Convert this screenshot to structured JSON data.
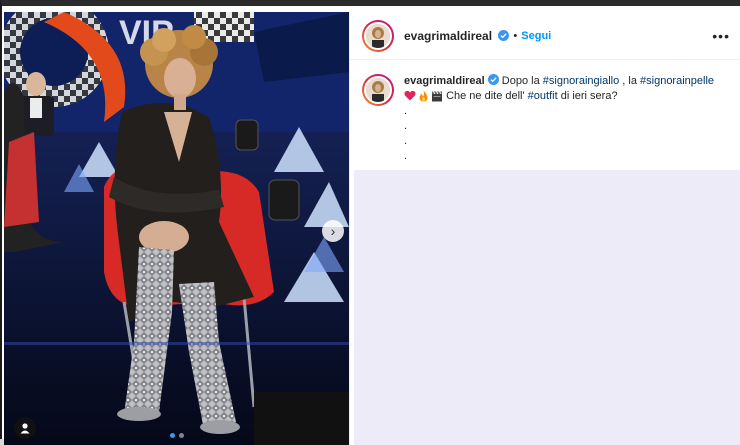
{
  "post": {
    "username": "evagrimaldireal",
    "separator": "•",
    "follow_label": "Segui",
    "more_label": "•••",
    "caption": {
      "part1": "Dopo la ",
      "tag1": "#signoraingiallo",
      "part2": " , la ",
      "tag2": "#signorainpelle",
      "part3": " Che ne dite dell' ",
      "tag3": "#outfit",
      "part4": " di ieri sera?",
      "emojis": [
        "heart-emoji",
        "fire-emoji",
        "clapperboard-emoji"
      ],
      "dot_lines": [
        ".",
        ".",
        ".",
        "."
      ]
    }
  },
  "media": {
    "carousel_index": 1,
    "carousel_total": 2,
    "next_icon": "chevron-right-icon",
    "user_tag_icon": "user-icon"
  },
  "colors": {
    "link_blue": "#0095f6",
    "hashtag": "#00376b",
    "panel": "#eeebf9"
  }
}
